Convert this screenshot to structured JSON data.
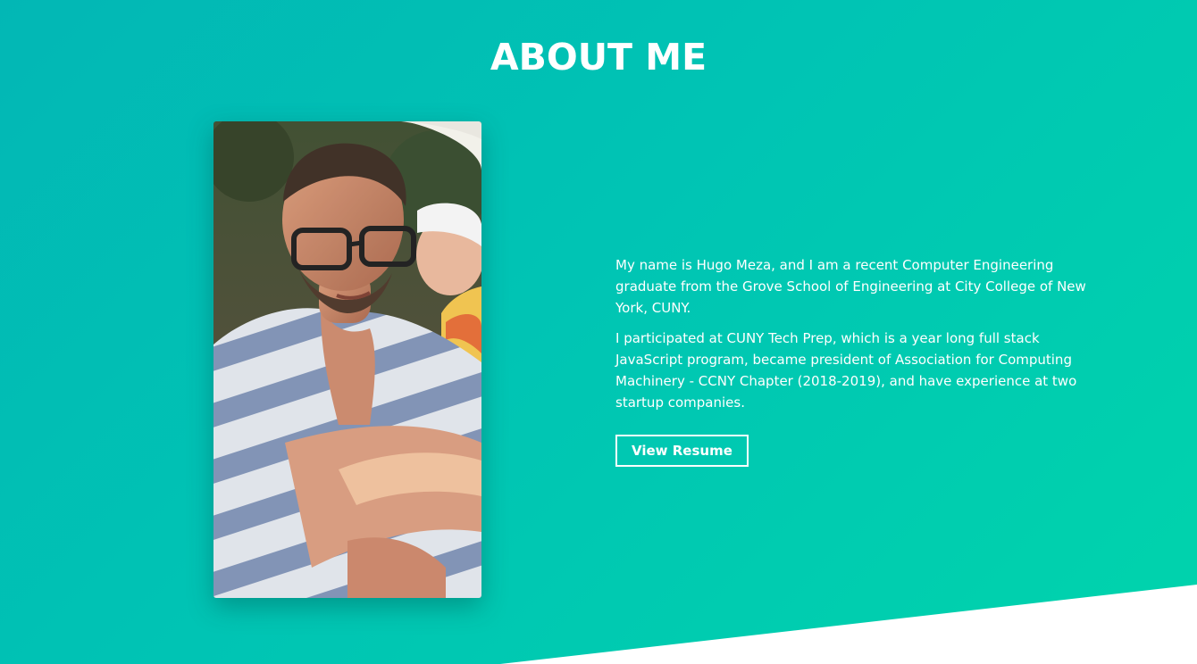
{
  "about": {
    "title": "ABOUT ME",
    "paragraphs": [
      "My name is Hugo Meza, and I am a recent Computer Engineering graduate from the Grove School of Engineering at City College of New York, CUNY.",
      "I participated at CUNY Tech Prep, which is a year long full stack JavaScript program, became president of Association for Computing Machinery - CCNY Chapter (2018-2019), and have experience at two startup companies."
    ],
    "resume_button_label": "View Resume"
  },
  "colors": {
    "gradient_start": "#02b7b5",
    "gradient_end": "#00d4ac",
    "text": "#ffffff",
    "wedge": "#ffffff"
  }
}
